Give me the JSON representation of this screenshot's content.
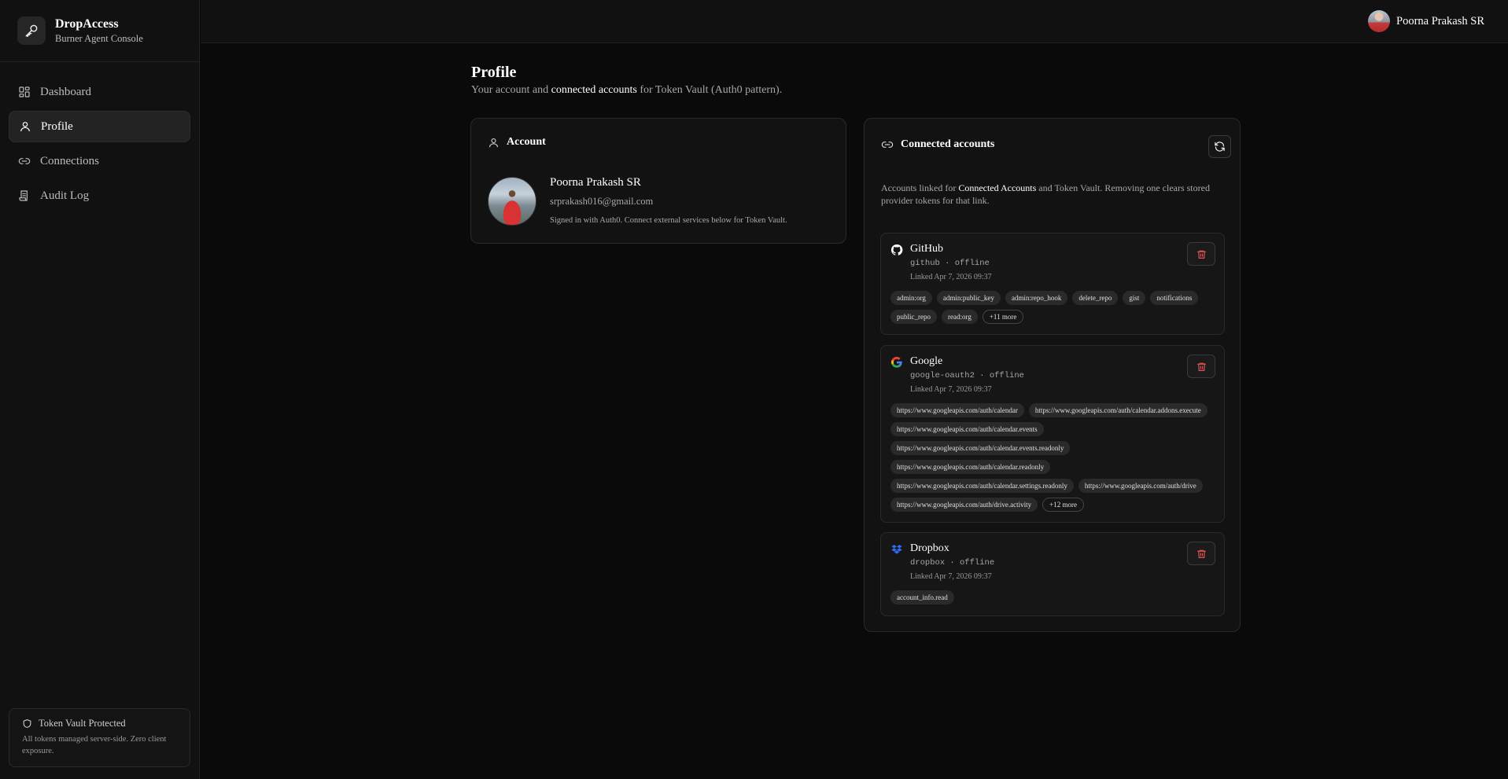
{
  "brand": {
    "name": "DropAccess",
    "subtitle": "Burner Agent Console",
    "icon": "key-icon"
  },
  "nav": [
    {
      "label": "Dashboard",
      "icon": "dashboard-icon",
      "active": false
    },
    {
      "label": "Profile",
      "icon": "user-icon",
      "active": true
    },
    {
      "label": "Connections",
      "icon": "link-icon",
      "active": false
    },
    {
      "label": "Audit Log",
      "icon": "audit-log-icon",
      "active": false
    }
  ],
  "vault": {
    "title": "Token Vault Protected",
    "description": "All tokens managed server-side. Zero client exposure."
  },
  "header": {
    "user_name": "Poorna Prakash SR"
  },
  "page": {
    "title": "Profile",
    "subtitle_pre": "Your account and ",
    "subtitle_hl": "connected accounts",
    "subtitle_post": " for Token Vault (Auth0 pattern)."
  },
  "account": {
    "title": "Account",
    "name": "Poorna Prakash SR",
    "email": "srprakash016@gmail.com",
    "note": "Signed in with Auth0. Connect external services below for Token Vault."
  },
  "connected": {
    "title": "Connected accounts",
    "desc_pre": "Accounts linked for ",
    "desc_hl": "Connected Accounts",
    "desc_post": " and Token Vault. Removing one clears stored provider tokens for that link.",
    "providers": [
      {
        "name": "GitHub",
        "meta": "github · offline",
        "linked": "Linked Apr 7, 2026 09:37",
        "icon": "github-icon",
        "scopes": [
          "admin:org",
          "admin:public_key",
          "admin:repo_hook",
          "delete_repo",
          "gist",
          "notifications",
          "public_repo",
          "read:org"
        ],
        "more": "+11 more"
      },
      {
        "name": "Google",
        "meta": "google-oauth2 · offline",
        "linked": "Linked Apr 7, 2026 09:37",
        "icon": "google-icon",
        "scopes": [
          "https://www.googleapis.com/auth/calendar",
          "https://www.googleapis.com/auth/calendar.addons.execute",
          "https://www.googleapis.com/auth/calendar.events",
          "https://www.googleapis.com/auth/calendar.events.readonly",
          "https://www.googleapis.com/auth/calendar.readonly",
          "https://www.googleapis.com/auth/calendar.settings.readonly",
          "https://www.googleapis.com/auth/drive",
          "https://www.googleapis.com/auth/drive.activity"
        ],
        "more": "+12 more"
      },
      {
        "name": "Dropbox",
        "meta": "dropbox · offline",
        "linked": "Linked Apr 7, 2026 09:37",
        "icon": "dropbox-icon",
        "scopes": [
          "account_info.read"
        ],
        "more": ""
      }
    ]
  },
  "colors": {
    "background": "#0a0a0a",
    "sidebar": "#111111",
    "danger": "#e05252",
    "dropbox": "#2f6df6"
  }
}
